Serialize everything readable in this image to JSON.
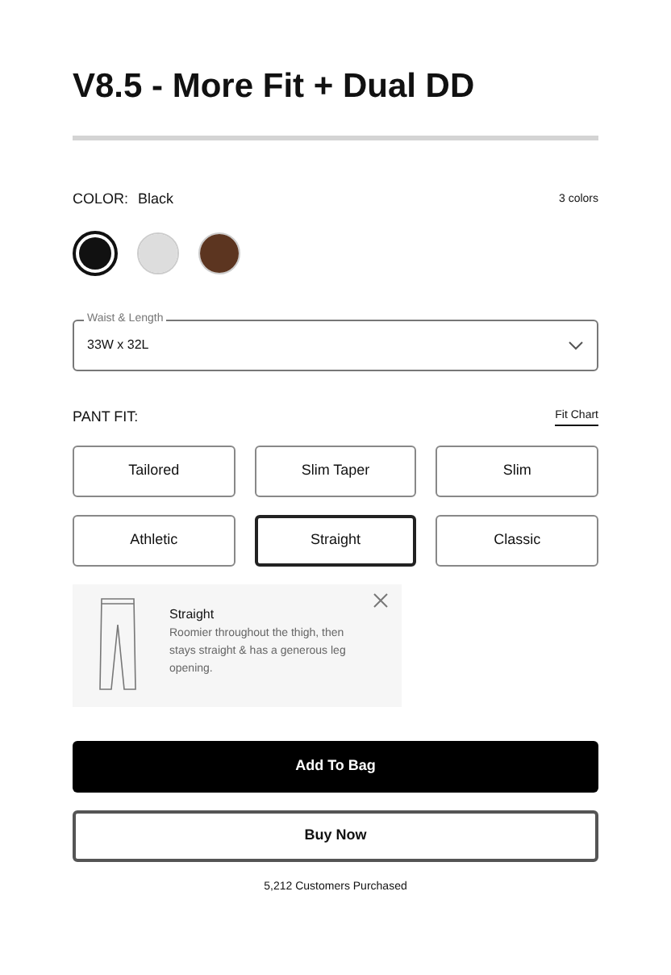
{
  "title": "V8.5 - More Fit + Dual DD",
  "color": {
    "label": "COLOR:",
    "value": "Black",
    "count": "3 colors",
    "swatches": [
      {
        "color": "#111111",
        "selected": true
      },
      {
        "color": "#dddddd",
        "selected": false
      },
      {
        "color": "#5c3520",
        "selected": false
      }
    ]
  },
  "size_field": {
    "label": "Waist & Length",
    "value": "33W x 32L"
  },
  "fit": {
    "label": "PANT FIT:",
    "chart_link": "Fit Chart",
    "options": [
      {
        "label": "Tailored",
        "selected": false
      },
      {
        "label": "Slim Taper",
        "selected": false
      },
      {
        "label": "Slim",
        "selected": false
      },
      {
        "label": "Athletic",
        "selected": false
      },
      {
        "label": "Straight",
        "selected": true
      },
      {
        "label": "Classic",
        "selected": false
      }
    ]
  },
  "fit_info": {
    "title": "Straight",
    "description": "Roomier throughout the thigh, then stays straight & has a generous leg opening."
  },
  "buttons": [
    {
      "label": "Add To Bag",
      "kind": "primary"
    },
    {
      "label": "Buy Now",
      "kind": "secondary"
    }
  ],
  "purchased": "5,212 Customers Purchased"
}
